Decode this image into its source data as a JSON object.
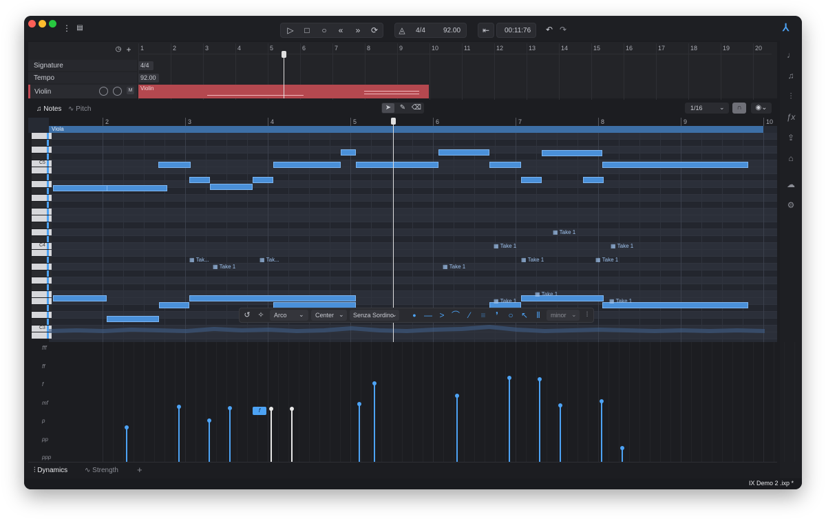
{
  "colors": {
    "accent": "#4da3f5",
    "track": "#c24a55",
    "window_bg": "#1c1d21"
  },
  "transport": {
    "play_icon": "play-icon",
    "stop_icon": "stop-icon",
    "record_icon": "record-icon",
    "rewind_icon": "rewind-icon",
    "forward_icon": "fast-forward-icon",
    "loop_icon": "loop-icon",
    "metronome_icon": "metronome-icon",
    "time_signature": "4/4",
    "tempo": "92.00",
    "position": "00:11:76"
  },
  "arrange": {
    "ruler": [
      "1",
      "2",
      "3",
      "4",
      "5",
      "6",
      "7",
      "8",
      "9",
      "10",
      "11",
      "12",
      "13",
      "14",
      "15",
      "16",
      "17",
      "18",
      "19",
      "20"
    ],
    "tracks": [
      {
        "label": "Signature",
        "value": "4/4"
      },
      {
        "label": "Tempo",
        "value": "92.00"
      }
    ],
    "instrument_track": {
      "name": "Violin",
      "mute": "M",
      "clip_label": "Violin"
    }
  },
  "editor": {
    "tabs": [
      {
        "label": "Notes"
      },
      {
        "label": "Pitch"
      }
    ],
    "quantize": "1/16",
    "ruler": [
      "2",
      "3",
      "4",
      "5",
      "6",
      "7",
      "8",
      "9",
      "10"
    ],
    "region_label": "Viola",
    "piano_labels": [
      "C5",
      "C4",
      "C3"
    ],
    "take_label": "Take 1",
    "take_label_short": "Tak...",
    "floating_toolbar": {
      "articulation": "Arco",
      "position": "Center",
      "mute": "Senza Sordino",
      "scale": "minor"
    }
  },
  "dynamics": {
    "levels": [
      "fff",
      "ff",
      "f",
      "mf",
      "p",
      "pp",
      "ppp"
    ],
    "selected_badge": "f"
  },
  "bottom_tabs": [
    {
      "label": "Dynamics"
    },
    {
      "label": "Strength"
    }
  ],
  "add_tab": "+",
  "status": {
    "filename": "IX Demo 2 .ixp *"
  }
}
